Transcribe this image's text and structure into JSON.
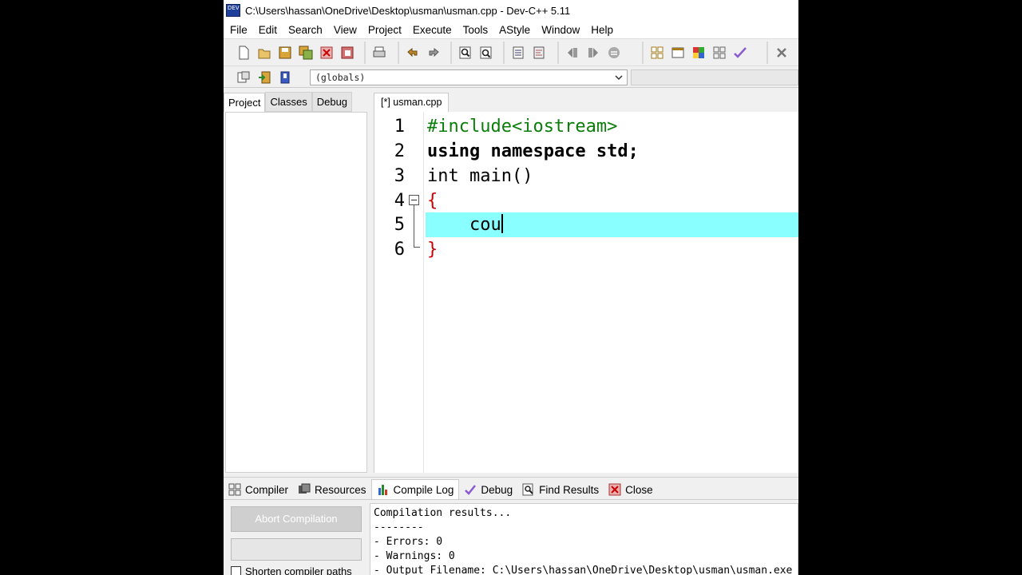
{
  "window": {
    "title": "C:\\Users\\hassan\\OneDrive\\Desktop\\usman\\usman.cpp - Dev-C++ 5.11",
    "icon_label": "DEV"
  },
  "menu": [
    "File",
    "Edit",
    "Search",
    "View",
    "Project",
    "Execute",
    "Tools",
    "AStyle",
    "Window",
    "Help"
  ],
  "toolbar": {
    "scope_value": "(globals)"
  },
  "left_panel": {
    "tabs": [
      "Project",
      "Classes",
      "Debug"
    ],
    "active_tab": "Project"
  },
  "editor": {
    "tab_label": "[*] usman.cpp",
    "current_line": 5,
    "lines": [
      {
        "num": "1",
        "text": "#include<iostream>"
      },
      {
        "num": "2",
        "text": "using namespace std;"
      },
      {
        "num": "3",
        "text": "int main()"
      },
      {
        "num": "4",
        "text": "{"
      },
      {
        "num": "5",
        "text": "    cou"
      },
      {
        "num": "6",
        "text": "}"
      }
    ],
    "highlight_color": "#89ffff"
  },
  "bottom_panel": {
    "tabs": [
      "Compiler",
      "Resources",
      "Compile Log",
      "Debug",
      "Find Results",
      "Close"
    ],
    "active_tab": "Compile Log",
    "abort_label": "Abort Compilation",
    "shorten_label": "Shorten compiler paths",
    "log_lines": [
      "Compilation results...",
      "--------",
      "- Errors: 0",
      "- Warnings: 0",
      "- Output Filename: C:\\Users\\hassan\\OneDrive\\Desktop\\usman\\usman.exe"
    ]
  }
}
